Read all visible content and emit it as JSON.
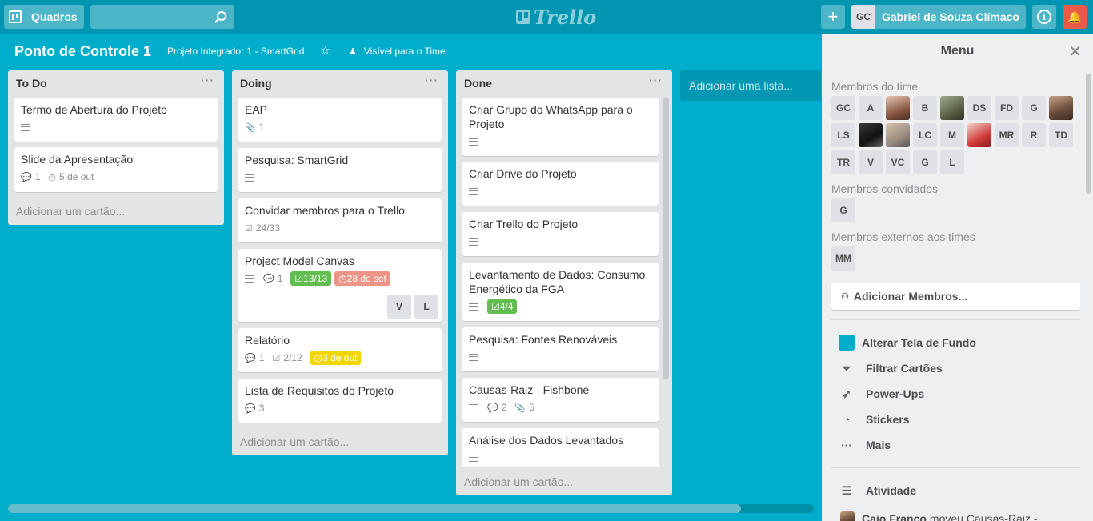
{
  "header": {
    "boards_label": "Quadros",
    "search_placeholder": "",
    "logo_text": "Trello",
    "add_label": "+",
    "user_initials": "GC",
    "user_name": "Gabriel de Souza Clímaco",
    "info_label": "i",
    "bell_label": "🔔"
  },
  "board": {
    "title": "Ponto de Controle 1",
    "team": "Projeto Integrador 1 - SmartGrid",
    "visibility": "Visível para o Time"
  },
  "lists": [
    {
      "name": "To Do",
      "add_card": "Adicionar um cartão...",
      "cards": [
        {
          "title": "Termo de Abertura do Projeto"
        },
        {
          "title": "Slide da Apresentação",
          "comments": "1",
          "due": "5 de out"
        }
      ]
    },
    {
      "name": "Doing",
      "add_card": "Adicionar um cartão...",
      "cards": [
        {
          "title": "EAP",
          "attachments": "1"
        },
        {
          "title": "Pesquisa: SmartGrid"
        },
        {
          "title": "Convidar membros para o Trello",
          "checklist": "24/33"
        },
        {
          "title": "Project Model Canvas",
          "comments": "1",
          "checklist": "13/13",
          "due": "28 de set",
          "members": [
            "V",
            "L"
          ]
        },
        {
          "title": "Relatório",
          "comments": "1",
          "checklist": "2/12",
          "due": "3 de out"
        },
        {
          "title": "Lista de Requisitos do Projeto",
          "comments": "3"
        }
      ]
    },
    {
      "name": "Done",
      "add_card": "Adicionar um cartão...",
      "cards": [
        {
          "title": "Criar Grupo do WhatsApp para o Projeto"
        },
        {
          "title": "Criar Drive do Projeto"
        },
        {
          "title": "Criar Trello do Projeto"
        },
        {
          "title": "Levantamento de Dados: Consumo Energético da FGA",
          "checklist": "4/4"
        },
        {
          "title": "Pesquisa: Fontes Renováveis"
        },
        {
          "title": "Causas-Raiz - Fishbone",
          "comments": "2",
          "attachments": "5"
        },
        {
          "title": "Análise dos Dados Levantados"
        }
      ]
    }
  ],
  "add_list": "Adicionar uma lista...",
  "menu": {
    "title": "Menu",
    "close": "✕",
    "team_members_label": "Membros do time",
    "team_members": [
      "GC",
      "A",
      "",
      "B",
      "",
      "DS",
      "FD",
      "G",
      "",
      "LS",
      "",
      "",
      "LC",
      "M",
      "",
      "MR",
      "R",
      "TD",
      "TR",
      "V",
      "VC",
      "G",
      "L"
    ],
    "invited_label": "Membros convidados",
    "invited": [
      "G"
    ],
    "external_label": "Membros externos aos times",
    "external": [
      "MM"
    ],
    "add_members": "Adicionar Membros...",
    "items": {
      "background": "Alterar Tela de Fundo",
      "filter": "Filtrar Cartões",
      "powerups": "Power-Ups",
      "stickers": "Stickers",
      "more": "Mais"
    },
    "activity_label": "Atividade",
    "activity_user": "Caio Franco",
    "activity_text": "moveu Causas-Raiz -"
  },
  "colors": {
    "board_bg": "#00aecc",
    "header_bg": "#0095b0",
    "green": "#61bd4f",
    "red": "#ec9488",
    "yellow": "#f2d600",
    "bell": "#eb5a46"
  }
}
